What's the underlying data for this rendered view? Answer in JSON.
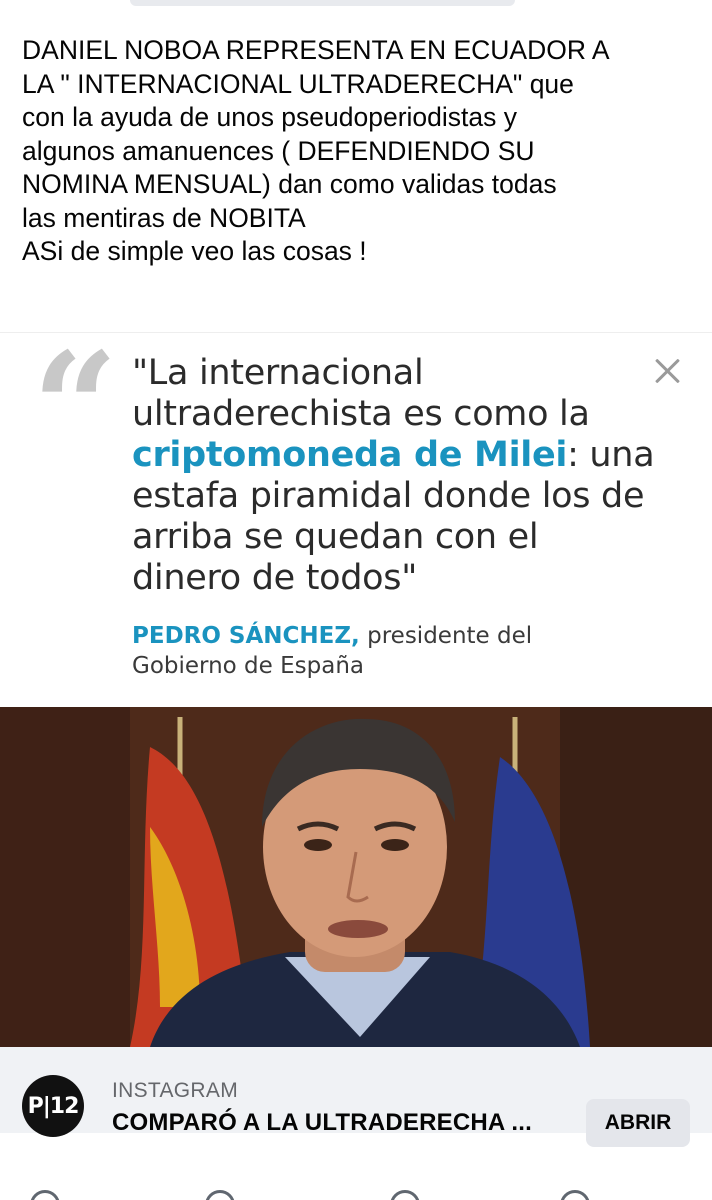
{
  "post": {
    "lines": [
      "DANIEL NOBOA REPRESENTA EN ECUADOR A",
      "LA \" INTERNACIONAL ULTRADERECHA\" que",
      "con la ayuda de unos  pseudoperiodistas y",
      "algunos amanuences ( DEFENDIENDO SU",
      "NOMINA  MENSUAL) dan como validas todas",
      "las mentiras de NOBITA",
      "ASi de simple veo las cosas !"
    ]
  },
  "quote": {
    "mark": "“",
    "line1": "\"La internacional",
    "line2": "ultraderechista es como la",
    "line3_highlight": "criptomoneda de Milei",
    "line3_rest": ": una",
    "line4": "estafa piramidal donde los de",
    "line5": "arriba se quedan con el",
    "line6": "dinero de todos\"",
    "author_name": "PEDRO SÁNCHEZ,",
    "author_role_1": " presidente del",
    "author_role_2": "Gobierno de España",
    "highlight_color": "#1a93bf"
  },
  "link": {
    "logo_text": "P|12",
    "source": "INSTAGRAM",
    "title": "COMPARÓ A LA ULTRADERECHA ...",
    "open_label": "ABRIR"
  },
  "icons": {
    "close": "close-icon",
    "quote": "quote-icon"
  }
}
